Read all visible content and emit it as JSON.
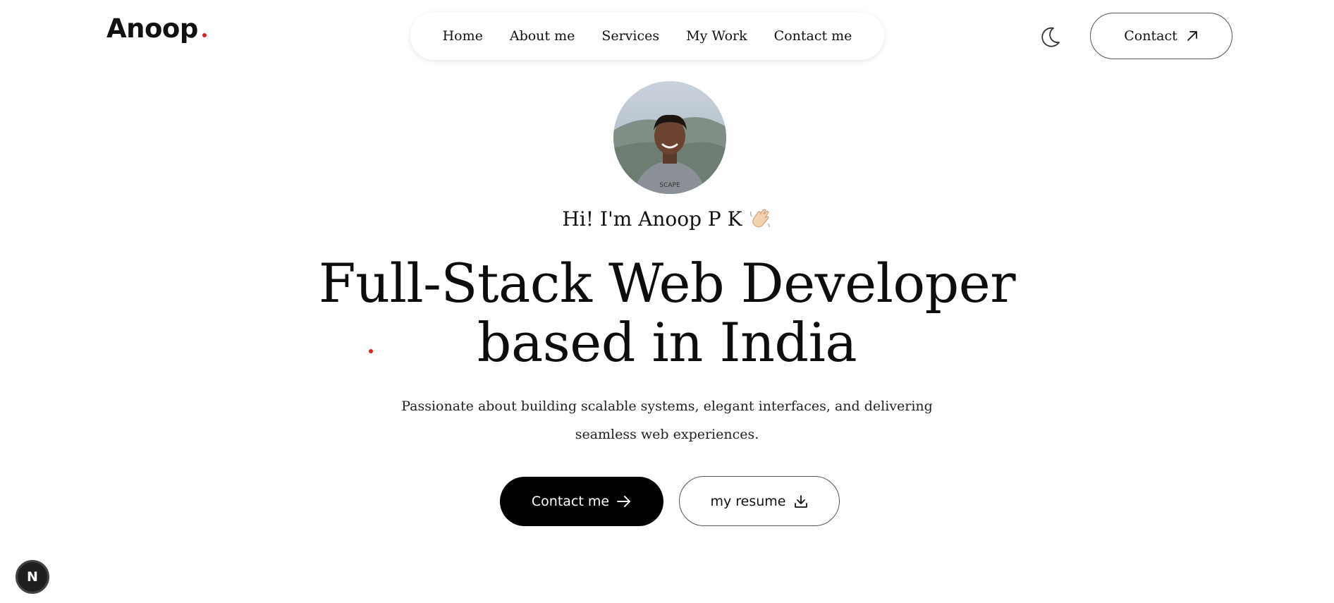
{
  "header": {
    "logo_text": "Anoop",
    "nav_items": [
      "Home",
      "About me",
      "Services",
      "My Work",
      "Contact me"
    ],
    "contact_label": "Contact"
  },
  "hero": {
    "greeting": "Hi! I'm Anoop P K",
    "headline_line1": "Full-Stack Web Developer",
    "headline_line2": "based in India",
    "subtitle": "Passionate about building scalable systems, elegant interfaces, and delivering seamless web experiences.",
    "primary_button_label": "Contact me",
    "secondary_button_label": "my resume"
  },
  "dev_badge": {
    "label": "N"
  },
  "colors": {
    "accent": "#e11d1d",
    "primary_button": "#000000",
    "text": "#111111"
  },
  "icons": {
    "theme_toggle": "moon-icon",
    "header_contact": "arrow-up-right-icon",
    "primary_button": "arrow-right-icon",
    "secondary_button": "download-icon",
    "greeting": "waving-hand-icon"
  }
}
